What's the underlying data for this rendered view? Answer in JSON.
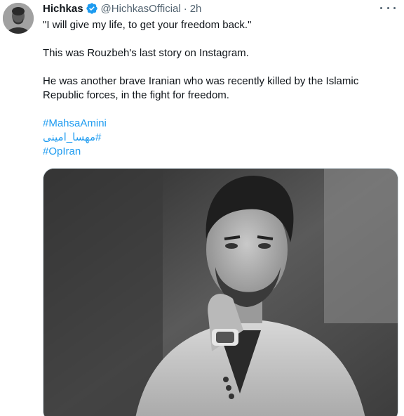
{
  "tweet": {
    "author_name": "Hichkas",
    "handle": "@HichkasOfficial",
    "separator": "·",
    "time": "2h",
    "lines": [
      "\"I will give my life, to get your freedom back.\"",
      "This was Rouzbeh's last story on Instagram.",
      "He was another brave Iranian who was recently killed by the Islamic Republic forces, in the fight for freedom."
    ],
    "hashtags": [
      "#MahsaAmini",
      "#مهسا_امینی",
      "#OpIran"
    ]
  },
  "icons": {
    "verified": "verified-badge-icon",
    "more": "more-options-icon"
  },
  "colors": {
    "link": "#1d9bf0",
    "secondary_text": "#536471",
    "verified_badge": "#1d9bf0"
  }
}
